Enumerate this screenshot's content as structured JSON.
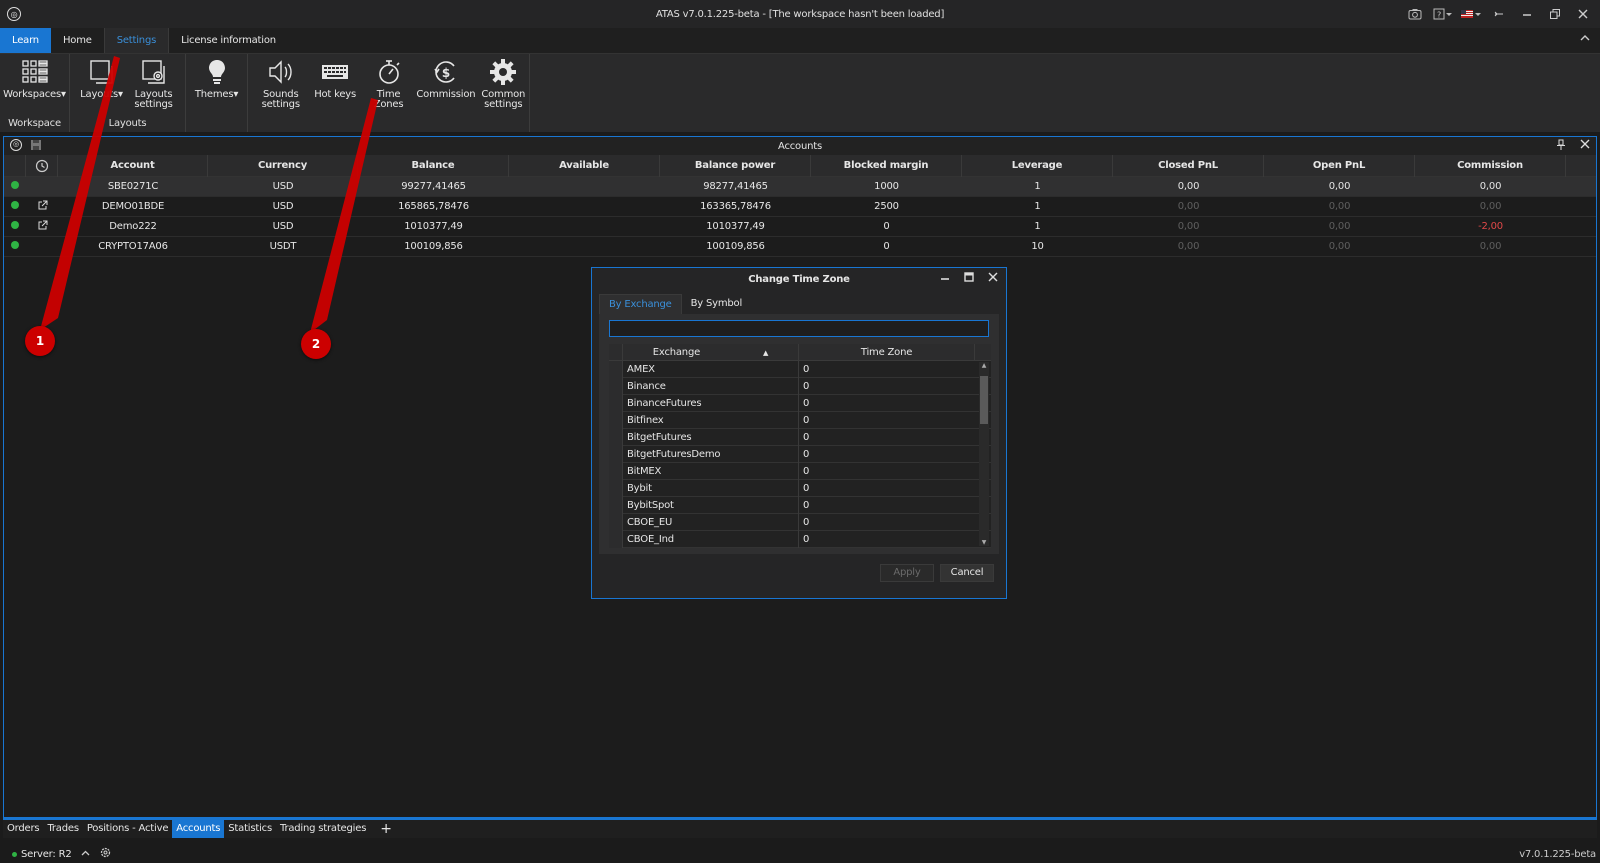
{
  "window": {
    "title": "ATAS v7.0.1.225-beta - [The workspace hasn't been loaded]"
  },
  "ribbon_tabs": [
    {
      "label": "Learn"
    },
    {
      "label": "Home"
    },
    {
      "label": "Settings"
    },
    {
      "label": "License information"
    }
  ],
  "ribbon": {
    "groups": [
      {
        "label": "Workspace",
        "buttons": [
          {
            "label": "Workspaces",
            "icon": "workspaces-icon"
          }
        ]
      },
      {
        "label": "Layouts",
        "buttons": [
          {
            "label": "Layouts",
            "icon": "layouts-icon"
          },
          {
            "label": "Layouts settings",
            "icon": "layouts-settings-icon"
          }
        ]
      },
      {
        "label": "",
        "buttons": [
          {
            "label": "Themes",
            "icon": "lightbulb-icon"
          }
        ]
      },
      {
        "label": "",
        "buttons": [
          {
            "label": "Sounds settings",
            "icon": "speaker-icon"
          },
          {
            "label": "Hot keys",
            "icon": "keyboard-icon"
          },
          {
            "label": "Time Zones",
            "icon": "stopwatch-icon"
          },
          {
            "label": "Commission",
            "icon": "dollar-icon"
          },
          {
            "label": "Common settings",
            "icon": "gear-icon"
          }
        ]
      }
    ]
  },
  "accounts_panel": {
    "title": "Accounts",
    "columns": [
      "Account",
      "Currency",
      "Balance",
      "Available",
      "Balance power",
      "Blocked margin",
      "Leverage",
      "Closed PnL",
      "Open PnL",
      "Commission"
    ],
    "rows": [
      {
        "account": "SBE0271C",
        "currency": "USD",
        "balance": "99277,41465",
        "available": "",
        "balance_power": "98277,41465",
        "blocked_margin": "1000",
        "leverage": "1",
        "closed_pnl": "0,00",
        "open_pnl": "0,00",
        "commission": "0,00"
      },
      {
        "account": "DEMO01BDE",
        "currency": "USD",
        "balance": "165865,78476",
        "available": "",
        "balance_power": "163365,78476",
        "blocked_margin": "2500",
        "leverage": "1",
        "closed_pnl": "0,00",
        "open_pnl": "0,00",
        "commission": "0,00"
      },
      {
        "account": "Demo222",
        "currency": "USD",
        "balance": "1010377,49",
        "available": "",
        "balance_power": "1010377,49",
        "blocked_margin": "0",
        "leverage": "1",
        "closed_pnl": "0,00",
        "open_pnl": "0,00",
        "commission": "-2,00"
      },
      {
        "account": "CRYPTO17A06",
        "currency": "USDT",
        "balance": "100109,856",
        "available": "",
        "balance_power": "100109,856",
        "blocked_margin": "0",
        "leverage": "10",
        "closed_pnl": "0,00",
        "open_pnl": "0,00",
        "commission": "0,00"
      }
    ]
  },
  "dialog": {
    "title": "Change Time Zone",
    "tabs": [
      "By Exchange",
      "By Symbol"
    ],
    "search_value": "",
    "columns": [
      "Exchange",
      "Time Zone"
    ],
    "rows": [
      {
        "exchange": "AMEX",
        "tz": "0"
      },
      {
        "exchange": "Binance",
        "tz": "0"
      },
      {
        "exchange": "BinanceFutures",
        "tz": "0"
      },
      {
        "exchange": "Bitfinex",
        "tz": "0"
      },
      {
        "exchange": "BitgetFutures",
        "tz": "0"
      },
      {
        "exchange": "BitgetFuturesDemo",
        "tz": "0"
      },
      {
        "exchange": "BitMEX",
        "tz": "0"
      },
      {
        "exchange": "Bybit",
        "tz": "0"
      },
      {
        "exchange": "BybitSpot",
        "tz": "0"
      },
      {
        "exchange": "CBOE_EU",
        "tz": "0"
      },
      {
        "exchange": "CBOE_Ind",
        "tz": "0"
      }
    ],
    "apply_label": "Apply",
    "cancel_label": "Cancel"
  },
  "bottom_tabs": [
    "Orders",
    "Trades",
    "Positions - Active",
    "Accounts",
    "Statistics",
    "Trading strategies"
  ],
  "status": {
    "server": "Server: R2",
    "version": "v7.0.1.225-beta"
  },
  "annotations": [
    "1",
    "2"
  ],
  "colors": {
    "accent": "#1976d2",
    "status_green": "#2fb344",
    "negative": "#e04848",
    "annotation_red": "#cc0000"
  }
}
